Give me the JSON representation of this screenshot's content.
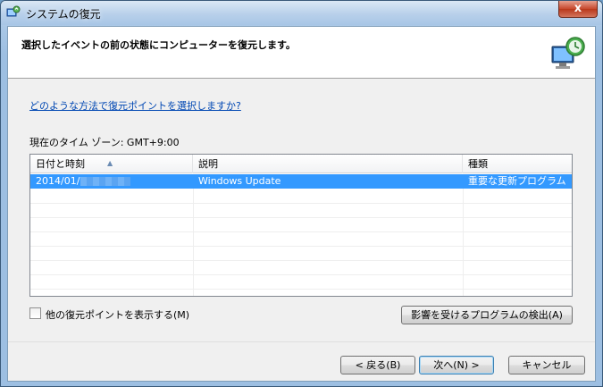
{
  "window": {
    "title": "システムの復元",
    "close_label": "x"
  },
  "header": {
    "text": "選択したイベントの前の状態にコンピューターを復元します。",
    "icon": "system-restore-icon"
  },
  "help_link": "どのような方法で復元ポイントを選択しますか?",
  "timezone_label": "現在のタイム ゾーン: GMT+9:00",
  "table": {
    "columns": [
      "日付と時刻",
      "説明",
      "種類"
    ],
    "rows": [
      {
        "date": "2014/01/",
        "description": "Windows Update",
        "type": "重要な更新プログラム",
        "selected": true
      }
    ]
  },
  "show_more_checkbox": {
    "label": "他の復元ポイントを表示する(M)",
    "checked": false
  },
  "scan_button": "影響を受けるプログラムの検出(A)",
  "buttons": {
    "back": "< 戻る(B)",
    "next": "次へ(N) >",
    "cancel": "キャンセル"
  },
  "colors": {
    "selection": "#3399ff",
    "link": "#0047b3"
  }
}
